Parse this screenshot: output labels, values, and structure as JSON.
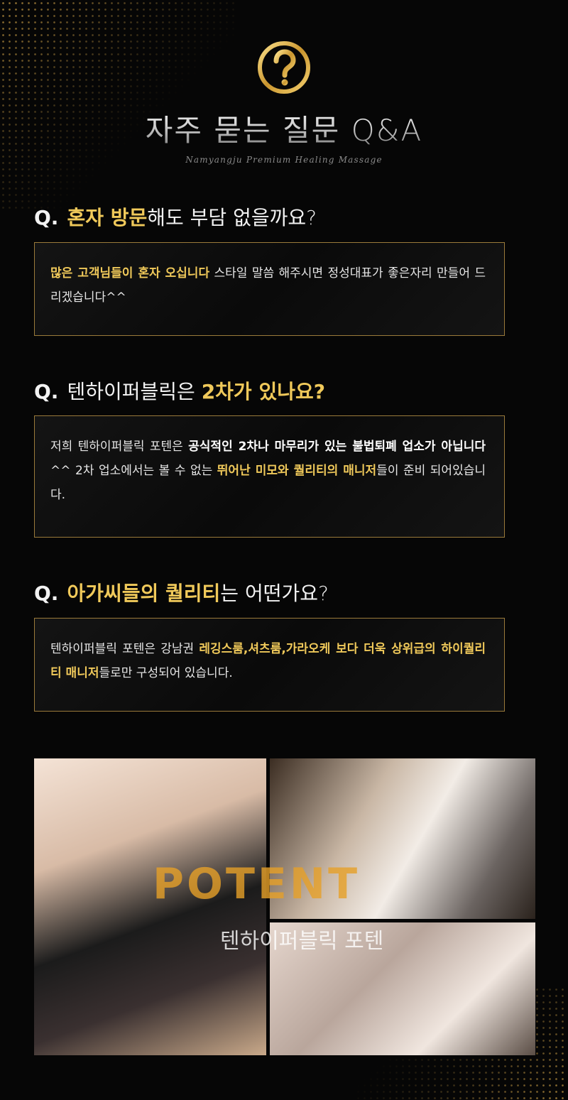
{
  "header": {
    "title": "자주 묻는 질문 Q&A",
    "subtitle": "Namyangju Premium Healing Massage"
  },
  "faq": [
    {
      "q_prefix": "Q.",
      "q_highlight": "혼자 방문",
      "q_rest": "해도 부담 없을까요?",
      "a_highlight": "많은 고객님들이 혼자 오십니다",
      "a_rest": " 스타일 말씀 해주시면 정성대표가 좋은자리 만들어 드리겠습니다^^"
    },
    {
      "q_prefix": "Q.",
      "q_text": "텐하이퍼블릭은 ",
      "q_highlight": "2차가 있나요?",
      "a_part1": "저희 텐하이퍼블릭 포텐은 ",
      "a_white": "공식적인 2차나 마무리가 있는 불법퇴폐 업소가 아닙니다",
      "a_part2": "^^ 2차 업소에서는 볼 수 없는 ",
      "a_gold": "뛰어난 미모와 퀄리티의 매니저",
      "a_part3": "들이 준비 되어있습니다."
    },
    {
      "q_prefix": "Q.",
      "q_highlight": "아가씨들의 퀄리티",
      "q_rest": "는 어떤가요?",
      "a_part1": "텐하이퍼블릭 포텐은 강남권 ",
      "a_gold1": "레깅스룸,셔츠룸,가라오케 보다 더욱 상위급의 하이퀄리티 매니저",
      "a_part2": "들로만 구성되어 있습니다."
    }
  ],
  "gallery": {
    "watermark_en": "POTENT",
    "watermark_ko": "텐하이퍼블릭 포텐"
  },
  "icons": [
    "question-circle-icon"
  ],
  "colors": {
    "gold": "#f0c95a",
    "border": "#9a7a3a",
    "background": "#060606"
  }
}
